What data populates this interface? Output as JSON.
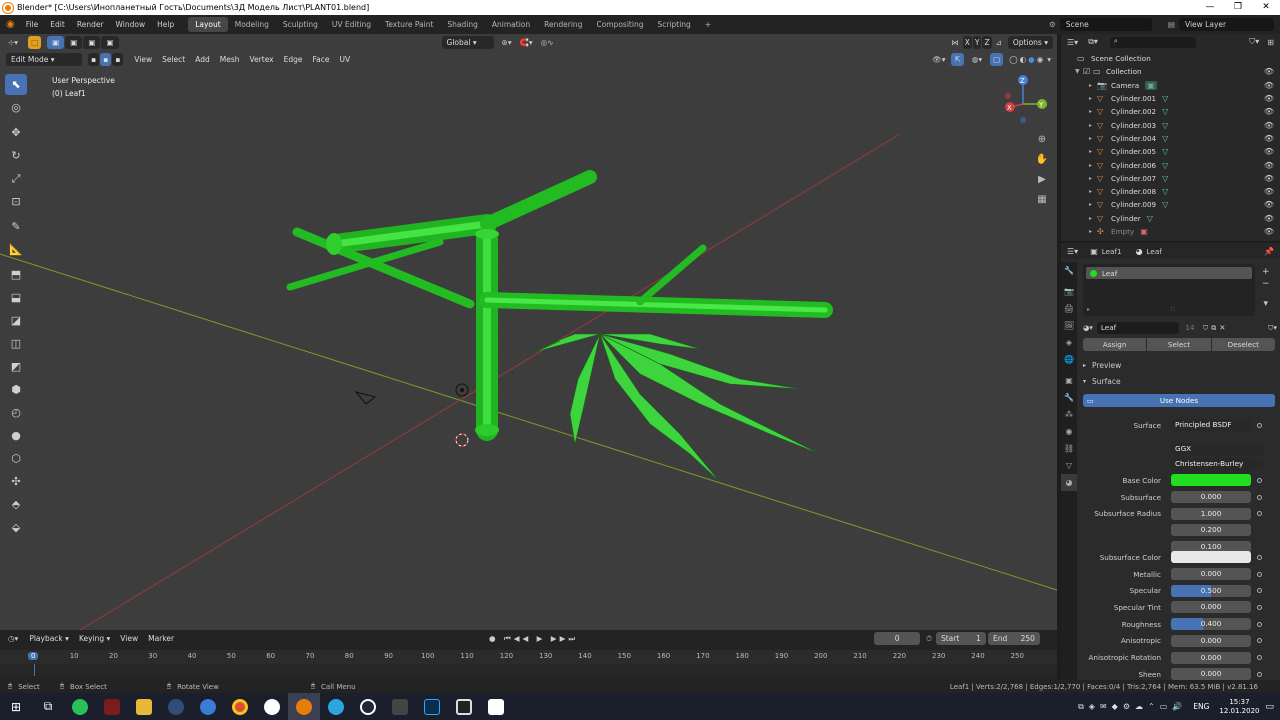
{
  "window": {
    "title": "Blender* [C:\\Users\\Инопланетный Гость\\Documents\\3Д Модель Лист\\PLANT01.blend]",
    "minimize": "—",
    "restore": "❐",
    "close": "✕"
  },
  "menu": [
    "File",
    "Edit",
    "Render",
    "Window",
    "Help"
  ],
  "workspaces": [
    "Layout",
    "Modeling",
    "Sculpting",
    "UV Editing",
    "Texture Paint",
    "Shading",
    "Animation",
    "Rendering",
    "Compositing",
    "Scripting"
  ],
  "active_workspace": "Layout",
  "add_workspace": "+",
  "scene": {
    "label": "Scene",
    "view_layer": "View Layer"
  },
  "viewport": {
    "transform_orientation": "Global",
    "options": "Options",
    "axis_toggles": [
      "X",
      "Y",
      "Z"
    ],
    "mode": "Edit Mode",
    "header_menus": [
      "View",
      "Select",
      "Add",
      "Mesh",
      "Vertex",
      "Edge",
      "Face",
      "UV"
    ],
    "perspective": "User Perspective",
    "object": "(0) Leaf1",
    "gizmo": {
      "z": "Z",
      "y": "Y",
      "x": "X"
    }
  },
  "outliner": {
    "root": "Scene Collection",
    "collection": "Collection",
    "items": [
      "Camera",
      "Cylinder.001",
      "Cylinder.002",
      "Cylinder.003",
      "Cylinder.004",
      "Cylinder.005",
      "Cylinder.006",
      "Cylinder.007",
      "Cylinder.008",
      "Cylinder.009",
      "Cylinder",
      "Empty"
    ]
  },
  "properties": {
    "object_name": "Leaf1",
    "material_name": "Leaf",
    "slot_label": "Leaf",
    "material_field": "Leaf",
    "users": "14",
    "assign": "Assign",
    "select": "Select",
    "deselect": "Deselect",
    "preview": "Preview",
    "surface_panel": "Surface",
    "use_nodes": "Use Nodes",
    "surface_label": "Surface",
    "surface_value": "Principled BSDF",
    "distribution": "GGX",
    "subsurface_method": "Christensen-Burley",
    "base_color_label": "Base Color",
    "base_color": "#1ee01e",
    "rows": [
      {
        "label": "Subsurface",
        "value": "0.000",
        "fill": 0
      },
      {
        "label": "Subsurface Radius",
        "value": "1.000",
        "fill": 0
      },
      {
        "label": "",
        "value": "0.200",
        "fill": 0
      },
      {
        "label": "",
        "value": "0.100",
        "fill": 0
      }
    ],
    "subsurface_color_label": "Subsurface Color",
    "subsurface_color": "#e8e8e8",
    "rows2": [
      {
        "label": "Metallic",
        "value": "0.000",
        "fill": 0
      },
      {
        "label": "Specular",
        "value": "0.500",
        "fill": 0.5
      },
      {
        "label": "Specular Tint",
        "value": "0.000",
        "fill": 0
      },
      {
        "label": "Roughness",
        "value": "0.400",
        "fill": 0.4
      },
      {
        "label": "Anisotropic",
        "value": "0.000",
        "fill": 0
      },
      {
        "label": "Anisotropic Rotation",
        "value": "0.000",
        "fill": 0
      },
      {
        "label": "Sheen",
        "value": "0.000",
        "fill": 0
      }
    ]
  },
  "timeline": {
    "menus": [
      "Playback",
      "Keying",
      "View",
      "Marker"
    ],
    "current_frame": "0",
    "start_label": "Start",
    "start": "1",
    "end_label": "End",
    "end": "250",
    "ticks": [
      "0",
      "10",
      "20",
      "30",
      "40",
      "50",
      "60",
      "70",
      "80",
      "90",
      "100",
      "110",
      "120",
      "130",
      "140",
      "150",
      "160",
      "170",
      "180",
      "190",
      "200",
      "210",
      "220",
      "230",
      "240",
      "250"
    ]
  },
  "statusbar": {
    "select": "Select",
    "box_select": "Box Select",
    "rotate": "Rotate View",
    "call_menu": "Call Menu",
    "stats": "Leaf1 | Verts:2/2,768 | Edges:1/2,770 | Faces:0/4 | Tris:2,764 | Mem: 63.5 MiB | v2.81.16"
  },
  "taskbar": {
    "lang": "ENG",
    "time": "15:37",
    "date": "12.01.2020"
  }
}
